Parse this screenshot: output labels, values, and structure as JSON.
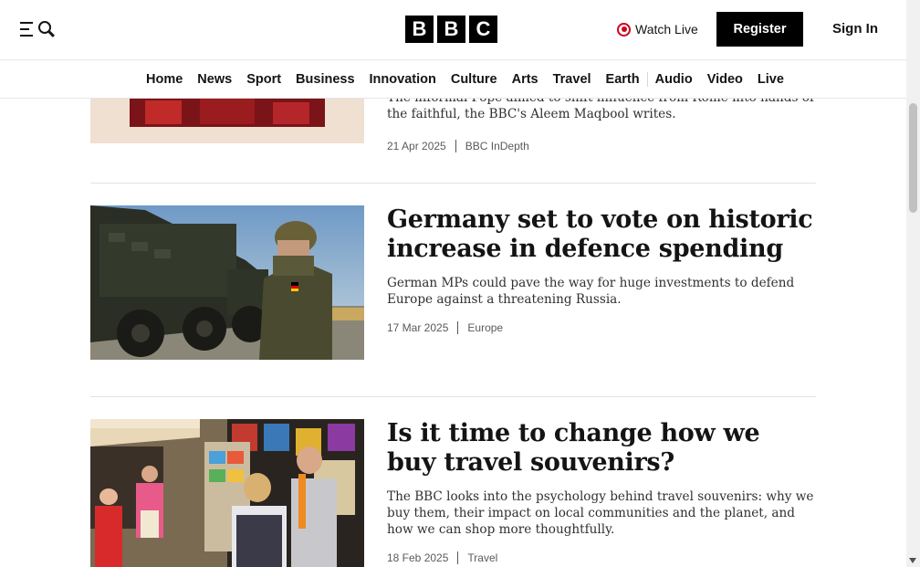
{
  "header": {
    "logo_letters": [
      "B",
      "B",
      "C"
    ],
    "watch_live_label": "Watch Live",
    "register_label": "Register",
    "signin_label": "Sign In"
  },
  "nav": {
    "items": [
      "Home",
      "News",
      "Sport",
      "Business",
      "Innovation",
      "Culture",
      "Arts",
      "Travel",
      "Earth",
      "Audio",
      "Video",
      "Live"
    ]
  },
  "articles": [
    {
      "headline": "",
      "summary": "The informal Pope aimed to shift influence from Rome into hands of the faithful, the BBC's Aleem Maqbool writes.",
      "date": "21 Apr 2025",
      "tag": "BBC InDepth",
      "image": "pope-story-image"
    },
    {
      "headline": "Germany set to vote on historic increase in defence spending",
      "summary": "German MPs could pave the way for huge investments to defend Europe against a threatening Russia.",
      "date": "17 Mar 2025",
      "tag": "Europe",
      "image": "soldier-military-vehicle-image"
    },
    {
      "headline": "Is it time to change how we buy travel souvenirs?",
      "summary": "The BBC looks into the psychology behind travel souvenirs: why we buy them, their impact on local communities and the planet, and how we can shop more thoughtfully.",
      "date": "18 Feb 2025",
      "tag": "Travel",
      "image": "souvenir-shop-tourists-image"
    }
  ],
  "colors": {
    "live_red": "#d0021b",
    "brand_black": "#000000"
  }
}
